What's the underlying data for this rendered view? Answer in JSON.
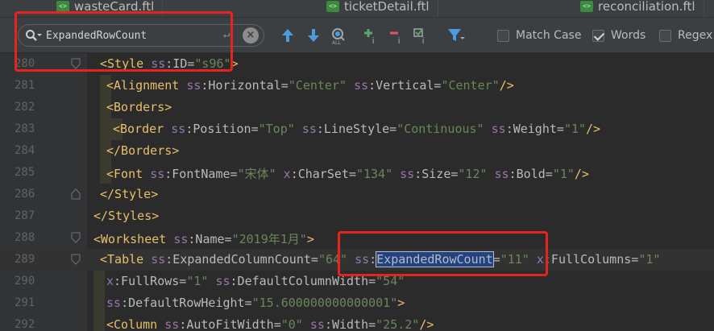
{
  "tabs": [
    {
      "label": "wasteCard.ftl",
      "icon": "ftl-file-icon"
    },
    {
      "label": "ticketDetail.ftl",
      "icon": "ftl-file-icon"
    },
    {
      "label": "reconciliation.ftl",
      "icon": "ftl-file-icon"
    }
  ],
  "search": {
    "value": "ExpandedRowCount",
    "options": [
      {
        "label": "Match Case",
        "checked": false
      },
      {
        "label": "Words",
        "checked": true
      },
      {
        "label": "Regex",
        "checked": false
      }
    ]
  },
  "toolbar": {
    "icons": [
      "prev-occurrence-icon",
      "next-occurrence-icon",
      "find-all-icon",
      "add-selection-icon",
      "remove-selection-icon",
      "select-all-occurrences-icon",
      "filter-icon"
    ]
  },
  "annotation_color": "#e8231f",
  "lines": [
    {
      "num": "280",
      "tokens": [
        [
          "t",
          "<Style "
        ],
        [
          "ns",
          "ss"
        ],
        [
          "at",
          ":ID="
        ],
        [
          "v",
          "\"s96\""
        ],
        [
          "t",
          ">"
        ]
      ]
    },
    {
      "num": "281",
      "tokens": [
        [
          "t",
          "<Alignment "
        ],
        [
          "ns",
          "ss"
        ],
        [
          "at",
          ":Horizontal="
        ],
        [
          "v",
          "\"Center\" "
        ],
        [
          "ns",
          "ss"
        ],
        [
          "at",
          ":Vertical="
        ],
        [
          "v",
          "\"Center\""
        ],
        [
          "t",
          "/>"
        ]
      ]
    },
    {
      "num": "282",
      "tokens": [
        [
          "t",
          "<Borders>"
        ]
      ]
    },
    {
      "num": "283",
      "tokens": [
        [
          "t",
          "<Border "
        ],
        [
          "ns",
          "ss"
        ],
        [
          "at",
          ":Position="
        ],
        [
          "v",
          "\"Top\" "
        ],
        [
          "ns",
          "ss"
        ],
        [
          "at",
          ":LineStyle="
        ],
        [
          "v",
          "\"Continuous\" "
        ],
        [
          "ns",
          "ss"
        ],
        [
          "at",
          ":Weight="
        ],
        [
          "v",
          "\"1\""
        ],
        [
          "t",
          "/>"
        ]
      ]
    },
    {
      "num": "284",
      "tokens": [
        [
          "t",
          "</Borders>"
        ]
      ]
    },
    {
      "num": "285",
      "tokens": [
        [
          "t",
          "<Font "
        ],
        [
          "ns",
          "ss"
        ],
        [
          "at",
          ":FontName="
        ],
        [
          "v",
          "\"宋体\" "
        ],
        [
          "ns",
          "x"
        ],
        [
          "at",
          ":CharSet="
        ],
        [
          "v",
          "\"134\" "
        ],
        [
          "ns",
          "ss"
        ],
        [
          "at",
          ":Size="
        ],
        [
          "v",
          "\"12\" "
        ],
        [
          "ns",
          "ss"
        ],
        [
          "at",
          ":Bold="
        ],
        [
          "v",
          "\"1\""
        ],
        [
          "t",
          "/>"
        ]
      ]
    },
    {
      "num": "286",
      "tokens": [
        [
          "t",
          "</Style>"
        ]
      ]
    },
    {
      "num": "287",
      "tokens": [
        [
          "t",
          "</Styles>"
        ]
      ]
    },
    {
      "num": "288",
      "tokens": [
        [
          "t",
          "<Worksheet "
        ],
        [
          "ns",
          "ss"
        ],
        [
          "at",
          ":Name="
        ],
        [
          "v",
          "\"2019年1月\""
        ],
        [
          "t",
          ">"
        ]
      ]
    },
    {
      "num": "289",
      "tokens": [
        [
          "t",
          "<Table "
        ],
        [
          "ns",
          "ss"
        ],
        [
          "at",
          ":ExpandedColumnCount="
        ],
        [
          "v",
          "\"64\" "
        ],
        [
          "ns",
          "ss"
        ],
        [
          "at",
          ":"
        ],
        [
          "sel",
          "ExpandedRowCount"
        ],
        [
          "at",
          "="
        ],
        [
          "v",
          "\"11\" "
        ],
        [
          "ns",
          "x"
        ],
        [
          "at",
          ":FullColumns="
        ],
        [
          "v",
          "\"1\""
        ]
      ]
    },
    {
      "num": "290",
      "tokens": [
        [
          "ns",
          "x"
        ],
        [
          "at",
          ":FullRows="
        ],
        [
          "v",
          "\"1\" "
        ],
        [
          "ns",
          "ss"
        ],
        [
          "at",
          ":DefaultColumnWidth="
        ],
        [
          "v",
          "\"54\""
        ]
      ]
    },
    {
      "num": "291",
      "tokens": [
        [
          "ns",
          "ss"
        ],
        [
          "at",
          ":DefaultRowHeight="
        ],
        [
          "v",
          "\"15.600000000000001\""
        ],
        [
          "t",
          ">"
        ]
      ]
    },
    {
      "num": "292",
      "tokens": [
        [
          "t",
          "<Column "
        ],
        [
          "ns",
          "ss"
        ],
        [
          "at",
          ":AutoFitWidth="
        ],
        [
          "v",
          "\"0\" "
        ],
        [
          "ns",
          "ss"
        ],
        [
          "at",
          ":Width="
        ],
        [
          "v",
          "\"25.2\""
        ],
        [
          "t",
          "/>"
        ]
      ]
    }
  ]
}
